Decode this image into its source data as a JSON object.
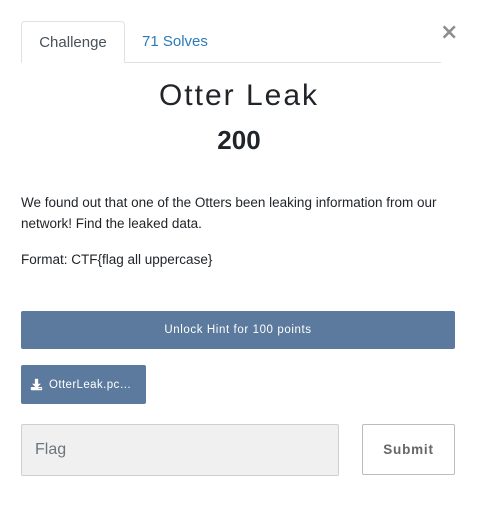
{
  "modal": {
    "close_glyph": "×",
    "tabs": [
      {
        "label": "Challenge",
        "active": true
      },
      {
        "label": "71 Solves",
        "active": false
      }
    ],
    "challenge": {
      "name": "Otter Leak",
      "value": "200",
      "description": "We found out that one of the Otters been leaking information from our network! Find the leaked data.",
      "format": "Format: CTF{flag all uppercase}"
    },
    "hint_button": "Unlock Hint for 100 points",
    "file": {
      "icon": "download-icon",
      "name": "OtterLeak.pc…"
    },
    "flag_input": {
      "value": "",
      "placeholder": "Flag"
    },
    "submit_label": "Submit"
  },
  "colors": {
    "accent": "#5b7a9e",
    "link": "#2b7bb9",
    "input_bg": "#f0f0f0"
  }
}
